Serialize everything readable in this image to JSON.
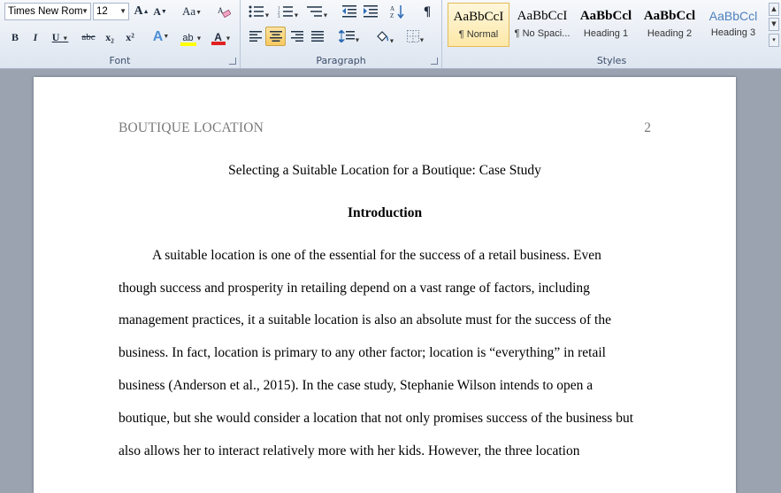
{
  "ribbon": {
    "font_group": {
      "label": "Font",
      "font_name": "Times New Rom",
      "font_size": "12",
      "grow_font": "A",
      "shrink_font": "A",
      "change_case": "Aa",
      "bold": "B",
      "italic": "I",
      "underline": "U",
      "strikethrough": "abc",
      "subscript": "x₂",
      "superscript": "x²",
      "text_effects": "A",
      "highlight": "ab",
      "font_color": "A",
      "font_color_value": "#e02020",
      "highlight_value": "#ffff00"
    },
    "paragraph_group": {
      "label": "Paragraph",
      "show_marks": "¶"
    },
    "styles_group": {
      "label": "Styles",
      "styles": [
        {
          "preview": "AaBbCcI",
          "name": "¶ Normal",
          "selected": true
        },
        {
          "preview": "AaBbCcI",
          "name": "¶ No Spaci...",
          "selected": false
        },
        {
          "preview": "AaBbCcl",
          "name": "Heading 1",
          "selected": false
        },
        {
          "preview": "AaBbCcl",
          "name": "Heading 2",
          "selected": false
        },
        {
          "preview": "AaBbCcl",
          "name": "Heading 3",
          "selected": false
        }
      ]
    }
  },
  "document": {
    "header_left": "BOUTIQUE LOCATION",
    "page_number": "2",
    "title": "Selecting a Suitable Location for a Boutique: Case Study",
    "heading": "Introduction",
    "lines": [
      "A suitable location is one of the essential for the success of a retail business.  Even",
      "though success and prosperity in retailing depend on a vast range of factors, including",
      "management practices, it a suitable location is also an absolute must for the success of the",
      "business. In fact, location is primary to any other factor; location is “everything” in retail",
      "business (Anderson et al., 2015). In the case study, Stephanie Wilson intends to open a",
      "boutique, but she would consider a location that not only promises success of the business but",
      "also allows her to interact relatively more with her kids. However, the three location"
    ]
  }
}
